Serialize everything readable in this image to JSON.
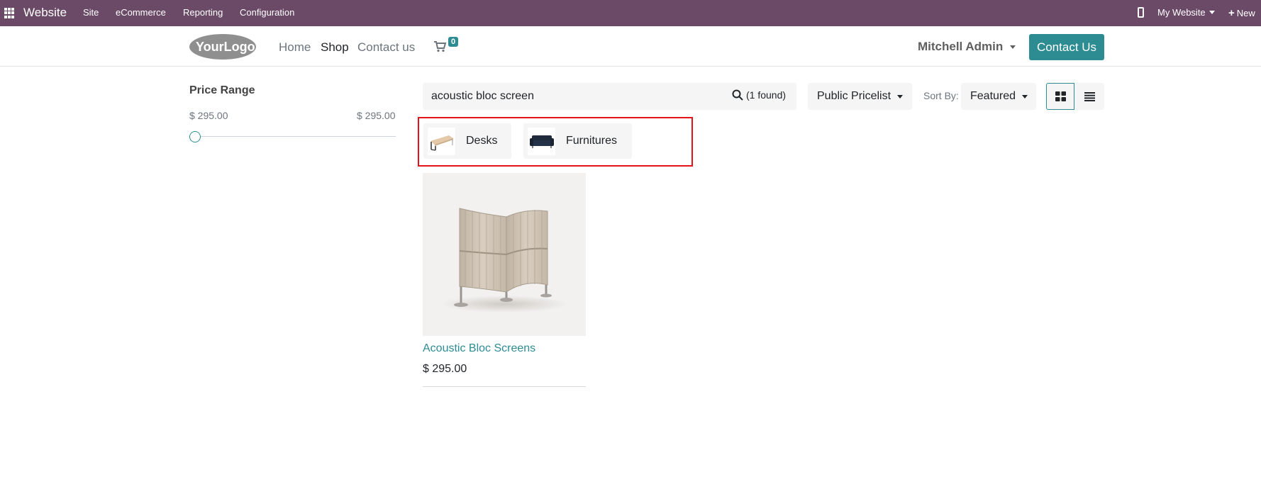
{
  "topbar": {
    "app_name": "Website",
    "menus": [
      "Site",
      "eCommerce",
      "Reporting",
      "Configuration"
    ],
    "my_website": "My Website",
    "new_label": "New",
    "background_color": "#6b4a67"
  },
  "header": {
    "logo_text": "YourLogo",
    "nav": [
      "Home",
      "Shop",
      "Contact us"
    ],
    "active_nav": "Shop",
    "cart_count": "0",
    "user": "Mitchell Admin",
    "contact_button": "Contact Us",
    "accent_color": "#2d8c91"
  },
  "sidebar": {
    "price_range_title": "Price Range",
    "price_min": "$ 295.00",
    "price_max": "$ 295.00"
  },
  "toolbar": {
    "search_value": "acoustic bloc screen",
    "found_text": "(1 found)",
    "pricelist": "Public Pricelist",
    "sort_label": "Sort By:",
    "sort_value": "Featured",
    "view_mode": "grid"
  },
  "categories": [
    {
      "label": "Desks",
      "icon": "desk-thumbnail"
    },
    {
      "label": "Furnitures",
      "icon": "sofa-thumbnail"
    }
  ],
  "products": [
    {
      "name": "Acoustic Bloc Screens",
      "price": "$ 295.00",
      "image": "acoustic-screen-image"
    }
  ]
}
